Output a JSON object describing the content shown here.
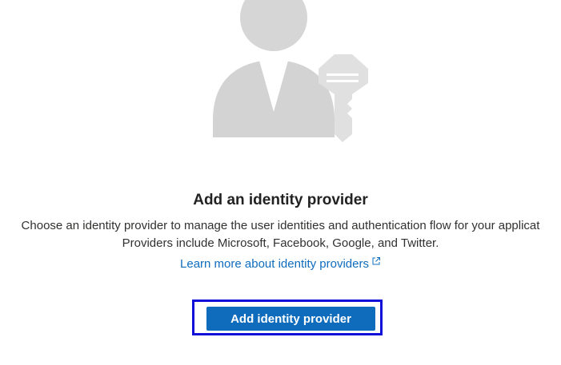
{
  "empty_state": {
    "illustration": "user-with-key-icon",
    "title": "Add an identity provider",
    "description_line1": "Choose an identity provider to manage the user identities and authentication flow for your applicat",
    "description_line2": "Providers include Microsoft, Facebook, Google, and Twitter.",
    "learn_more_label": "Learn more about identity providers",
    "learn_more_icon": "external-link-icon",
    "add_button_label": "Add identity provider"
  },
  "colors": {
    "accent": "#0f6cbd",
    "focus_ring": "#1010d8",
    "illustration_gray": "#d3d3d3"
  }
}
